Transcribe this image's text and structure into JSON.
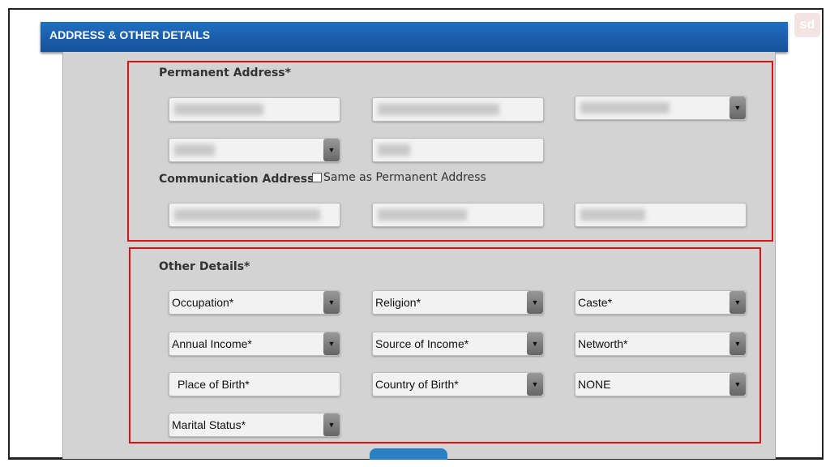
{
  "header": {
    "title": "ADDRESS & OTHER DETAILS",
    "logo": "sd"
  },
  "permanent_address": {
    "label": "Permanent Address*"
  },
  "communication_address": {
    "label": "Communication Address*",
    "same_as_label": "Same as Permanent Address",
    "same_as_checked": false
  },
  "other_details": {
    "label": "Other Details*",
    "fields": {
      "occupation": "Occupation*",
      "religion": "Religion*",
      "caste": "Caste*",
      "annual_income": "Annual Income*",
      "source_of_income": "Source of Income*",
      "networth": "Networth*",
      "place_of_birth": "Place of Birth*",
      "country_of_birth": "Country of Birth*",
      "none": "NONE",
      "marital_status": "Marital Status*"
    }
  },
  "colors": {
    "header": "#1f6fc0",
    "highlight": "#e01010"
  }
}
